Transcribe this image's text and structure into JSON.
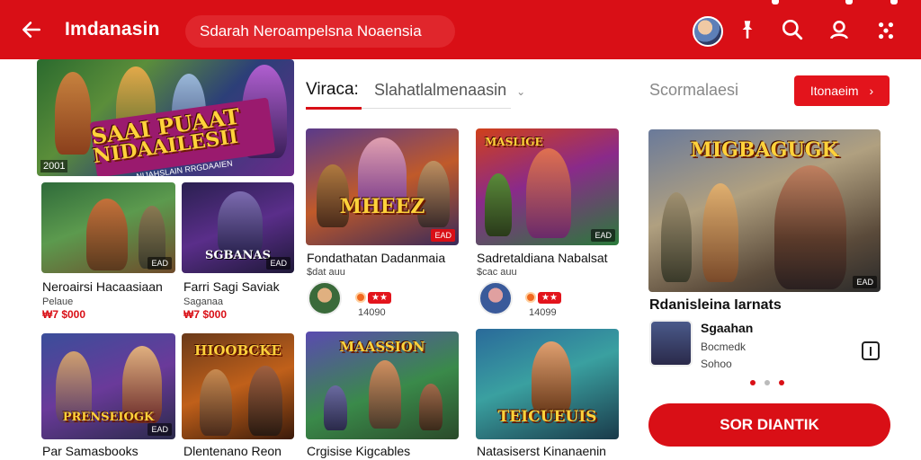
{
  "appbar": {
    "title": "Imdanasin",
    "search_text": "Sdarah Neroampelsna Noaensia",
    "icons": [
      "arrow-back-icon",
      "avatar",
      "pin-icon",
      "search-icon",
      "profile-icon",
      "more-icon"
    ]
  },
  "hero": {
    "line1": "SAAI PUAAT",
    "line2": "NIDAAILESII",
    "ribbon": "NIJAHSLAIN RRGDAAIEN",
    "corner": "2001"
  },
  "filter": {
    "label": "Viraca:",
    "value": "Slahatlalmenaasin"
  },
  "right": {
    "label": "Scormalaesi",
    "button": "Itonaeim"
  },
  "left_cards": [
    {
      "title": "Neroairsi Hacaasiaan",
      "sub": "Pelaue",
      "price": "₩7 $000",
      "badge": "EAD"
    },
    {
      "title": "Farri Sagi Saviak",
      "sub": "Saganaa",
      "price": "₩7 $000",
      "badge": "EAD",
      "wm": "SGBANAS"
    },
    {
      "title": "Par Samasbooks",
      "badge": "EAD",
      "wm": "PRENSEIOGK"
    },
    {
      "title": "Dlentenano Reon",
      "wm": "HIOOBCKE"
    }
  ],
  "mid_cards": [
    {
      "title": "Fondathatan Dadanmaia",
      "sub": "$dat auu",
      "rating": "14090",
      "badge": "EAD",
      "wm": "MHEEZ"
    },
    {
      "title": "Sadretaldiana Nabalsat",
      "sub": "$cac auu",
      "rating": "14099",
      "badge": "EAD",
      "wm": "MASLIGE"
    },
    {
      "title": "Crgisise Kigcables",
      "wm": "MAASSION"
    },
    {
      "title": "Natasiserst Kinanaenin",
      "wm": "TEICUEUIS"
    }
  ],
  "feature": {
    "wm": "MIGBAGUGK",
    "badge": "EAD",
    "title": "Rdanisleina Iarnats",
    "author": "Sgaahan",
    "meta1": "Bocmedk",
    "meta2": "Sohoo"
  },
  "cta": "SOR DIANTIK",
  "colors": {
    "accent": "#d90f16",
    "ribbon": "#9a1a6e"
  }
}
